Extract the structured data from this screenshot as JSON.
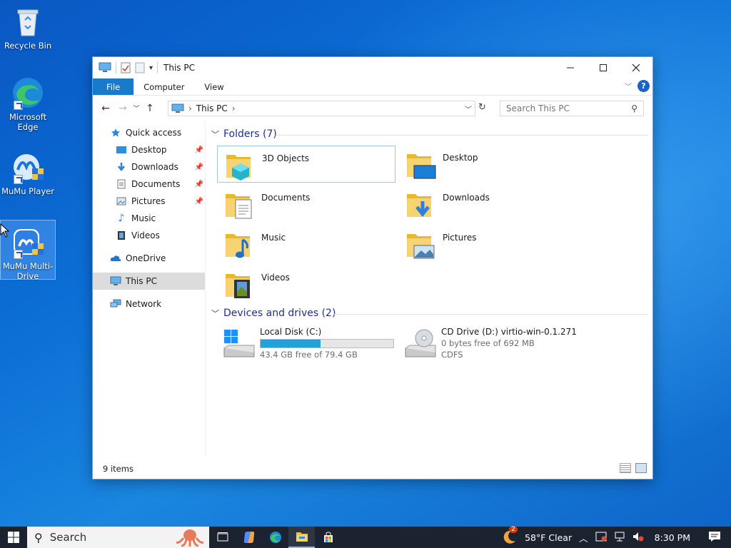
{
  "desktop": {
    "icons": [
      {
        "label": "Recycle Bin"
      },
      {
        "label": "Microsoft Edge"
      },
      {
        "label": "MuMu Player"
      },
      {
        "label": "MuMu Multi-Drive"
      }
    ]
  },
  "window": {
    "title": "This PC",
    "ribbon": {
      "file": "File",
      "computer": "Computer",
      "view": "View",
      "help": "?"
    },
    "address": {
      "location": "This PC"
    },
    "search": {
      "placeholder": "Search This PC"
    },
    "sidebar": {
      "quick_access": "Quick access",
      "items": [
        {
          "label": "Desktop",
          "pinned": true
        },
        {
          "label": "Downloads",
          "pinned": true
        },
        {
          "label": "Documents",
          "pinned": true
        },
        {
          "label": "Pictures",
          "pinned": true
        },
        {
          "label": "Music",
          "pinned": false
        },
        {
          "label": "Videos",
          "pinned": false
        }
      ],
      "onedrive": "OneDrive",
      "this_pc": "This PC",
      "network": "Network"
    },
    "folders": {
      "header": "Folders (7)",
      "items": [
        "3D Objects",
        "Desktop",
        "Documents",
        "Downloads",
        "Music",
        "Pictures",
        "Videos"
      ]
    },
    "drives": {
      "header": "Devices and drives (2)",
      "items": [
        {
          "name": "Local Disk (C:)",
          "free_text": "43.4 GB free of 79.4 GB",
          "used_fraction": 0.45
        },
        {
          "name": "CD Drive (D:) virtio-win-0.1.271",
          "free_text": "0 bytes free of 692 MB",
          "fs": "CDFS"
        }
      ]
    },
    "status": "9 items"
  },
  "taskbar": {
    "search": "Search",
    "weather": "58°F  Clear",
    "weather_badge": "2",
    "time": "8:30 PM"
  },
  "colors": {
    "accent": "#1979ca",
    "desktop": "#0b6fd6",
    "drive_bar": "#26a0da",
    "taskbar": "#1c2330"
  }
}
